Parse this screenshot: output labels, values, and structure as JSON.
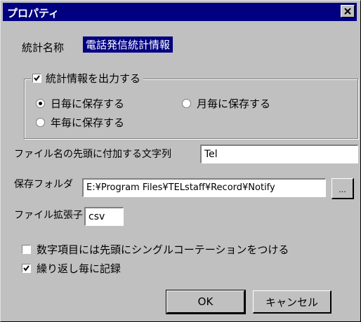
{
  "window": {
    "title": "プロパティ"
  },
  "stat_name": {
    "label": "統計名称",
    "value": "電話発信統計情報"
  },
  "output_group": {
    "checkbox_label": "統計情報を出力する",
    "checked": true,
    "options": [
      {
        "label": "日毎に保存する",
        "selected": true
      },
      {
        "label": "月毎に保存する",
        "selected": false
      },
      {
        "label": "年毎に保存する",
        "selected": false
      }
    ]
  },
  "filename_prefix": {
    "label": "ファイル名の先頭に付加する文字列",
    "value": "Tel"
  },
  "save_folder": {
    "label": "保存フォルダ",
    "value": "E:¥Program Files¥TELstaff¥Record¥Notify",
    "browse_label": "..."
  },
  "file_ext": {
    "label": "ファイル拡張子",
    "value": "csv"
  },
  "options": [
    {
      "label": "数字項目には先頭にシングルコーテーションをつける",
      "checked": false
    },
    {
      "label": "繰り返し毎に記録",
      "checked": true
    }
  ],
  "buttons": {
    "ok": "OK",
    "cancel": "キャンセル"
  }
}
